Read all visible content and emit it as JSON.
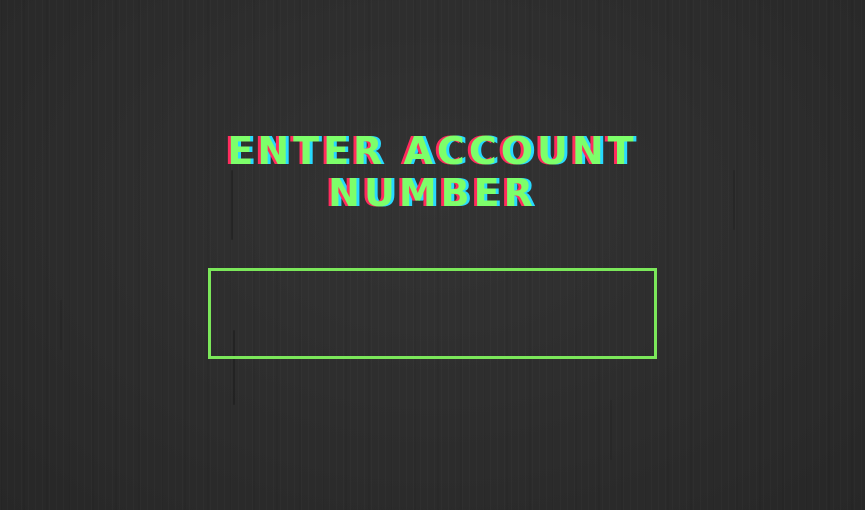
{
  "prompt": {
    "line1": "ENTER ACCOUNT",
    "line2": "NUMBER"
  },
  "account_input": {
    "value": "",
    "placeholder": ""
  },
  "colors": {
    "background": "#2b2b2b",
    "accent_green": "#7dff6a",
    "glitch_red": "#ff2b5e",
    "glitch_cyan": "#27d9ff",
    "input_border": "#7be75a"
  }
}
